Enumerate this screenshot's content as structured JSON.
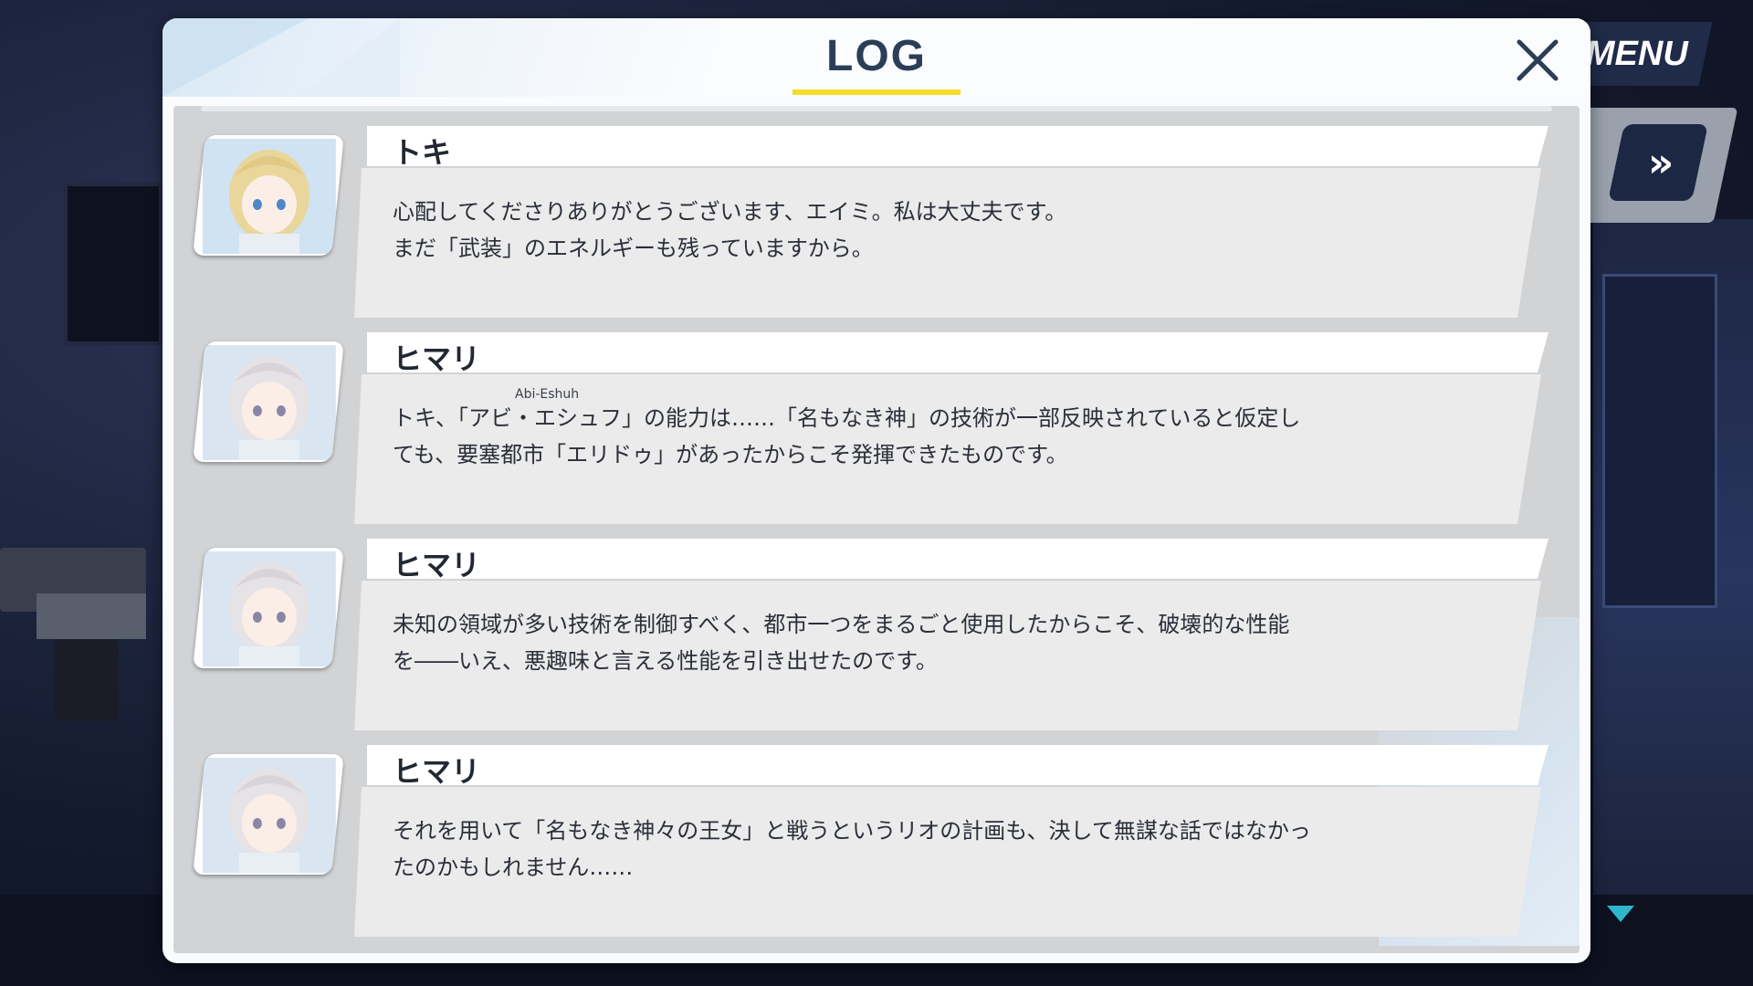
{
  "hud": {
    "menu_label": "MENU",
    "fast_forward_label": "»"
  },
  "log": {
    "title": "LOG",
    "entries": [
      {
        "speaker": "トキ",
        "portrait_icon": "toki-portrait-icon",
        "ruby": "",
        "lines": [
          "心配してくださりありがとうございます、エイミ。私は大丈夫です。",
          "まだ「武装」のエネルギーも残っていますから。"
        ]
      },
      {
        "speaker": "ヒマリ",
        "portrait_icon": "himari-portrait-icon",
        "ruby": "Abi-Eshuh",
        "lines": [
          "トキ、「アビ・エシュフ」の能力は……「名もなき神」の技術が一部反映されていると仮定し",
          "ても、要塞都市「エリドゥ」があったからこそ発揮できたものです。"
        ]
      },
      {
        "speaker": "ヒマリ",
        "portrait_icon": "himari-portrait-icon",
        "ruby": "",
        "lines": [
          "未知の領域が多い技術を制御すべく、都市一つをまるごと使用したからこそ、破壊的な性能",
          "を――いえ、悪趣味と言える性能を引き出せたのです。"
        ]
      },
      {
        "speaker": "ヒマリ",
        "portrait_icon": "himari-portrait-icon",
        "ruby": "",
        "lines": [
          "それを用いて「名もなき神々の王女」と戦うというリオの計画も、決して無謀な話ではなかっ",
          "たのかもしれません……"
        ]
      }
    ]
  },
  "colors": {
    "accent_underline": "#f3dd2a",
    "menu_bg": "#1f2b48",
    "scroll_arrow": "#2fb6cc",
    "title_text": "#2c3e57"
  }
}
